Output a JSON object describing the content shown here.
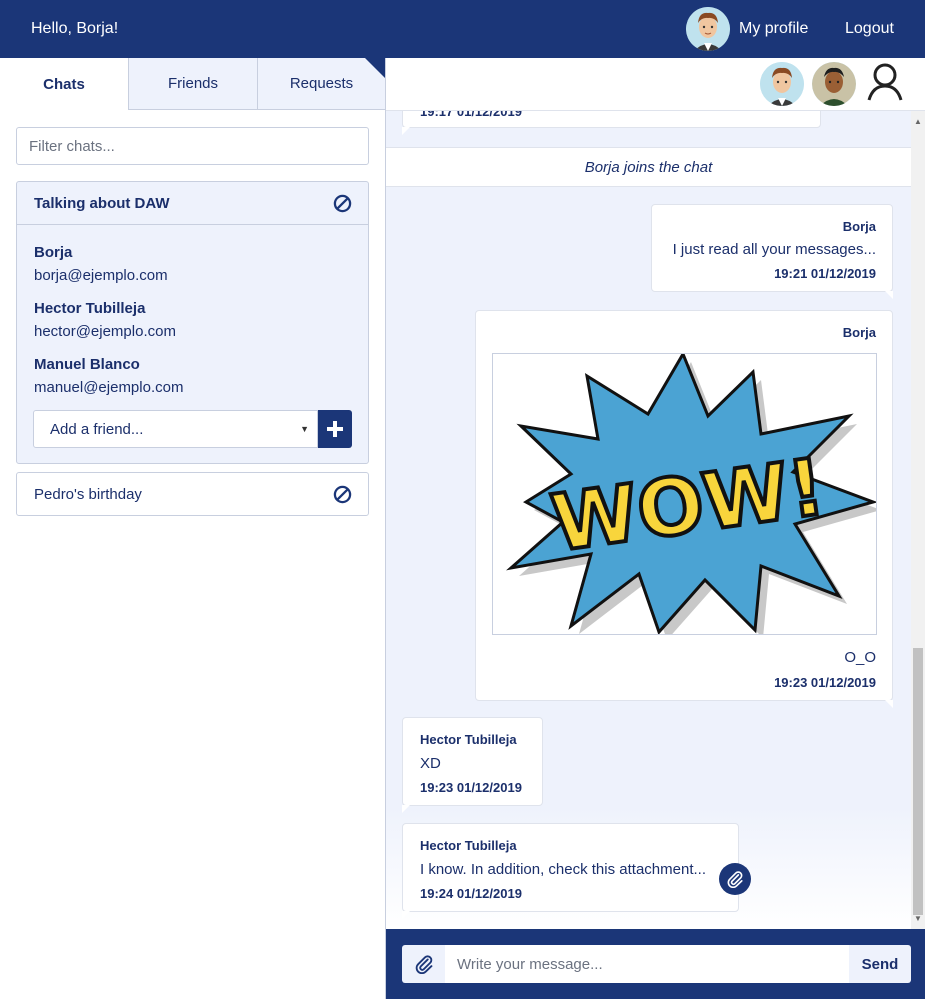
{
  "header": {
    "greeting": "Hello, Borja!",
    "profile_label": "My profile",
    "logout_label": "Logout"
  },
  "sidebar": {
    "tabs": [
      {
        "label": "Chats",
        "active": true
      },
      {
        "label": "Friends",
        "active": false
      },
      {
        "label": "Requests",
        "active": false
      }
    ],
    "filter_placeholder": "Filter chats...",
    "chats": [
      {
        "name": "Talking about DAW",
        "expanded": true,
        "members": [
          {
            "name": "Borja",
            "email": "borja@ejemplo.com"
          },
          {
            "name": "Hector Tubilleja",
            "email": "hector@ejemplo.com"
          },
          {
            "name": "Manuel Blanco",
            "email": "manuel@ejemplo.com"
          }
        ],
        "add_friend_placeholder": "Add a friend..."
      },
      {
        "name": "Pedro's birthday",
        "expanded": false
      }
    ]
  },
  "conversation": {
    "partial_time": "19:17 01/12/2019",
    "system_message": "Borja joins the chat",
    "messages": [
      {
        "author": "Borja",
        "text": "I just read all your messages...",
        "time": "19:21 01/12/2019",
        "own": true
      },
      {
        "author": "Borja",
        "image": "wow-comic-image",
        "image_text": "WOW!",
        "text": "O_O",
        "time": "19:23 01/12/2019",
        "own": true
      },
      {
        "author": "Hector Tubilleja",
        "text": "XD",
        "time": "19:23 01/12/2019",
        "own": false
      },
      {
        "author": "Hector Tubilleja",
        "text": "I know. In addition, check this attachment...",
        "time": "19:24 01/12/2019",
        "own": false,
        "attachment": true
      }
    ]
  },
  "composer": {
    "placeholder": "Write your message...",
    "send_label": "Send"
  },
  "colors": {
    "primary": "#1b3678",
    "panel_bg": "#eef2fc",
    "border": "#c8cfdf"
  }
}
